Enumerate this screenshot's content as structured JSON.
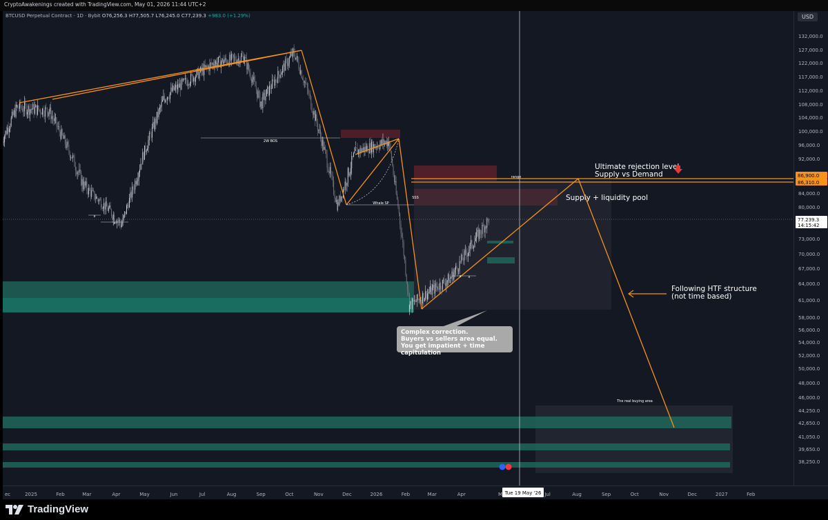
{
  "header": {
    "attribution": "CryptoAwakenings created with TradingView.com, May 01, 2026 11:44 UTC+2",
    "symbol": "BTCUSD Perpetual Contract · 1D · Bybit",
    "open": "O76,256.3",
    "high": "H77,505.7",
    "low": "L76,245.0",
    "close": "C77,239.3",
    "change": "+983.0 (+1.29%)"
  },
  "currency": "USD",
  "footer": {
    "brand": "TradingView"
  },
  "price_labels": {
    "p1": "86,900.0",
    "p2": "86,310.0",
    "last": "77,239.3",
    "countdown": "14:15:42"
  },
  "crosshair_date": "Tue 19 May '26",
  "annotations": {
    "rejection": "Ultimate rejection level",
    "supply_demand": "Supply vs Demand",
    "supply_pool": "Supply + liquidity pool",
    "htf_1": "Following HTF structure",
    "htf_2": "(not time based)",
    "bos": "2W BOS",
    "whale": "Whale SP",
    "range": "range",
    "sss": "SSS",
    "buying_area": "The real buying area",
    "x_mark": "x",
    "callout_1": "Complex correction.",
    "callout_2": "Buyers vs sellers area equal.",
    "callout_3": "You get impatient + time capitulation"
  },
  "colors": {
    "background": "#141822",
    "orange": "#f7931a",
    "teal": "#1f6b5e",
    "red_zone": "#7a2530",
    "up": "#d1d4dc",
    "down": "#787b86"
  },
  "chart_data": {
    "type": "candlestick",
    "title": "",
    "price_axis": {
      "ticks": [
        "132,000.0",
        "127,000.0",
        "122,000.0",
        "117,000.0",
        "112,000.0",
        "108,000.0",
        "104,000.0",
        "100,000.0",
        "96,000.0",
        "92,000.0",
        "84,000.0",
        "80,000.0",
        "73,000.0",
        "70,000.0",
        "67,000.0",
        "64,000.0",
        "61,000.0",
        "58,000.0",
        "56,000.0",
        "54,000.0",
        "52,000.0",
        "50,000.0",
        "48,000.0",
        "46,000.0",
        "44,250.0",
        "42,650.0",
        "41,050.0",
        "39,650.0",
        "38,250.0"
      ],
      "values": [
        132000,
        127000,
        122000,
        117000,
        112000,
        108000,
        104000,
        100000,
        96000,
        92000,
        84000,
        80000,
        73000,
        70000,
        67000,
        64000,
        61000,
        58000,
        56000,
        54000,
        52000,
        50000,
        48000,
        46000,
        44250,
        42650,
        41050,
        39650,
        38250
      ]
    },
    "time_axis": {
      "labels": [
        "2025",
        "Feb",
        "Mar",
        "Apr",
        "May",
        "Jun",
        "Jul",
        "Aug",
        "Sep",
        "Oct",
        "Nov",
        "Dec",
        "2026",
        "Feb",
        "Mar",
        "Apr",
        "Jul",
        "Aug",
        "Sep",
        "Oct",
        "Nov",
        "Dec",
        "2027",
        "Feb"
      ],
      "partial_left": "ec",
      "partial_crosshair": "M"
    },
    "approx_price_path": [
      {
        "date": "2024-12-01",
        "price": 97000
      },
      {
        "date": "2024-12-17",
        "price": 107000
      },
      {
        "date": "2025-01-20",
        "price": 106000
      },
      {
        "date": "2025-02-25",
        "price": 86000
      },
      {
        "date": "2025-04-07",
        "price": 76000
      },
      {
        "date": "2025-05-22",
        "price": 110000
      },
      {
        "date": "2025-07-14",
        "price": 122000
      },
      {
        "date": "2025-08-14",
        "price": 124000
      },
      {
        "date": "2025-09-01",
        "price": 108000
      },
      {
        "date": "2025-10-06",
        "price": 126000
      },
      {
        "date": "2025-11-21",
        "price": 80600
      },
      {
        "date": "2025-12-10",
        "price": 94000
      },
      {
        "date": "2026-01-14",
        "price": 97000
      },
      {
        "date": "2026-02-05",
        "price": 60000
      },
      {
        "date": "2026-03-20",
        "price": 65000
      },
      {
        "date": "2026-04-30",
        "price": 77239
      }
    ],
    "last_price": 77239.3,
    "levels": {
      "ultimate_rejection": [
        86310,
        86900
      ]
    }
  }
}
